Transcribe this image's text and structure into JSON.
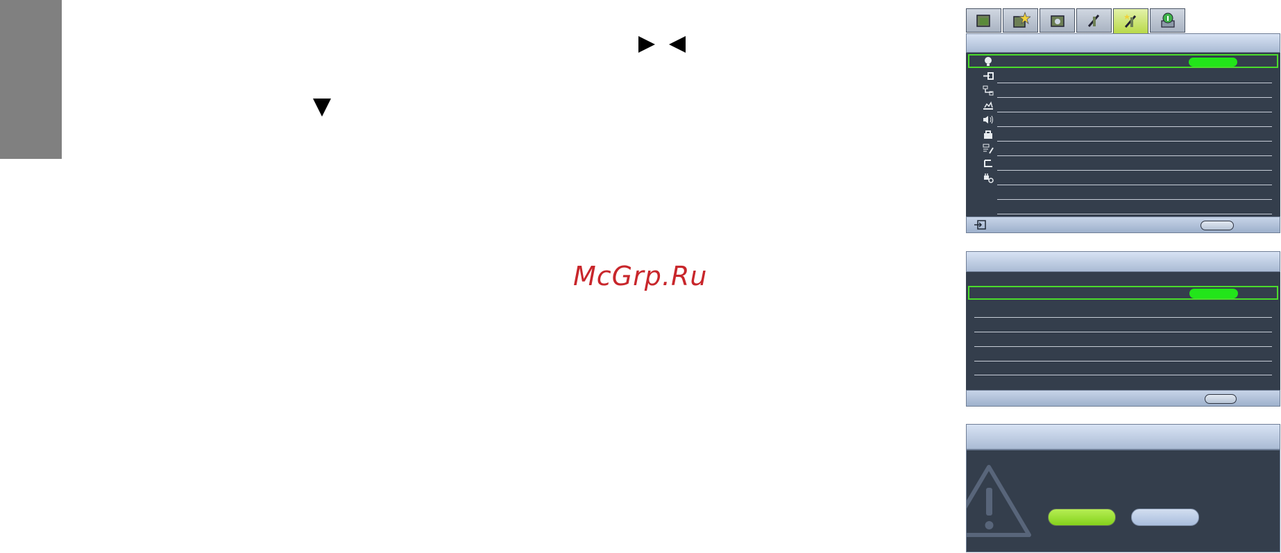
{
  "page": {
    "side_tab": "side-tab"
  },
  "arrows": {
    "right": "right-arrow",
    "left": "left-arrow",
    "down": "down-arrow"
  },
  "watermark": {
    "text": "McGrp.Ru",
    "color": "#c8262b"
  },
  "osd_menu": {
    "tabs": [
      {
        "icon": "picture-icon",
        "active": false
      },
      {
        "icon": "picture-advanced-icon",
        "active": false
      },
      {
        "icon": "display-icon",
        "active": false
      },
      {
        "icon": "setup-basic-icon",
        "active": false
      },
      {
        "icon": "setup-advanced-icon",
        "active": true
      },
      {
        "icon": "information-icon",
        "active": false
      }
    ],
    "rows": [
      {
        "icon": "lamp-icon",
        "selected": true
      },
      {
        "icon": "input-icon",
        "selected": false
      },
      {
        "icon": "network-icon",
        "selected": false
      },
      {
        "icon": "test-pattern-icon",
        "selected": false
      },
      {
        "icon": "audio-icon",
        "selected": false
      },
      {
        "icon": "lock-icon",
        "selected": false
      },
      {
        "icon": "settings-edit-icon",
        "selected": false
      },
      {
        "icon": "reset-icon",
        "selected": false
      },
      {
        "icon": "power-icon",
        "selected": false
      },
      {
        "icon": "",
        "selected": false
      }
    ],
    "footer_icon": "exit-icon",
    "colors": {
      "highlight": "#4bdc2c",
      "background": "#343e4c",
      "title_bar": "#c3d1e6"
    }
  },
  "submenu": {
    "row_count": 7
  },
  "dialog": {
    "icon": "warning-icon",
    "buttons": [
      {
        "name": "confirm",
        "color": "#9ae22c"
      },
      {
        "name": "cancel",
        "color": "#b7c9e6"
      }
    ]
  }
}
